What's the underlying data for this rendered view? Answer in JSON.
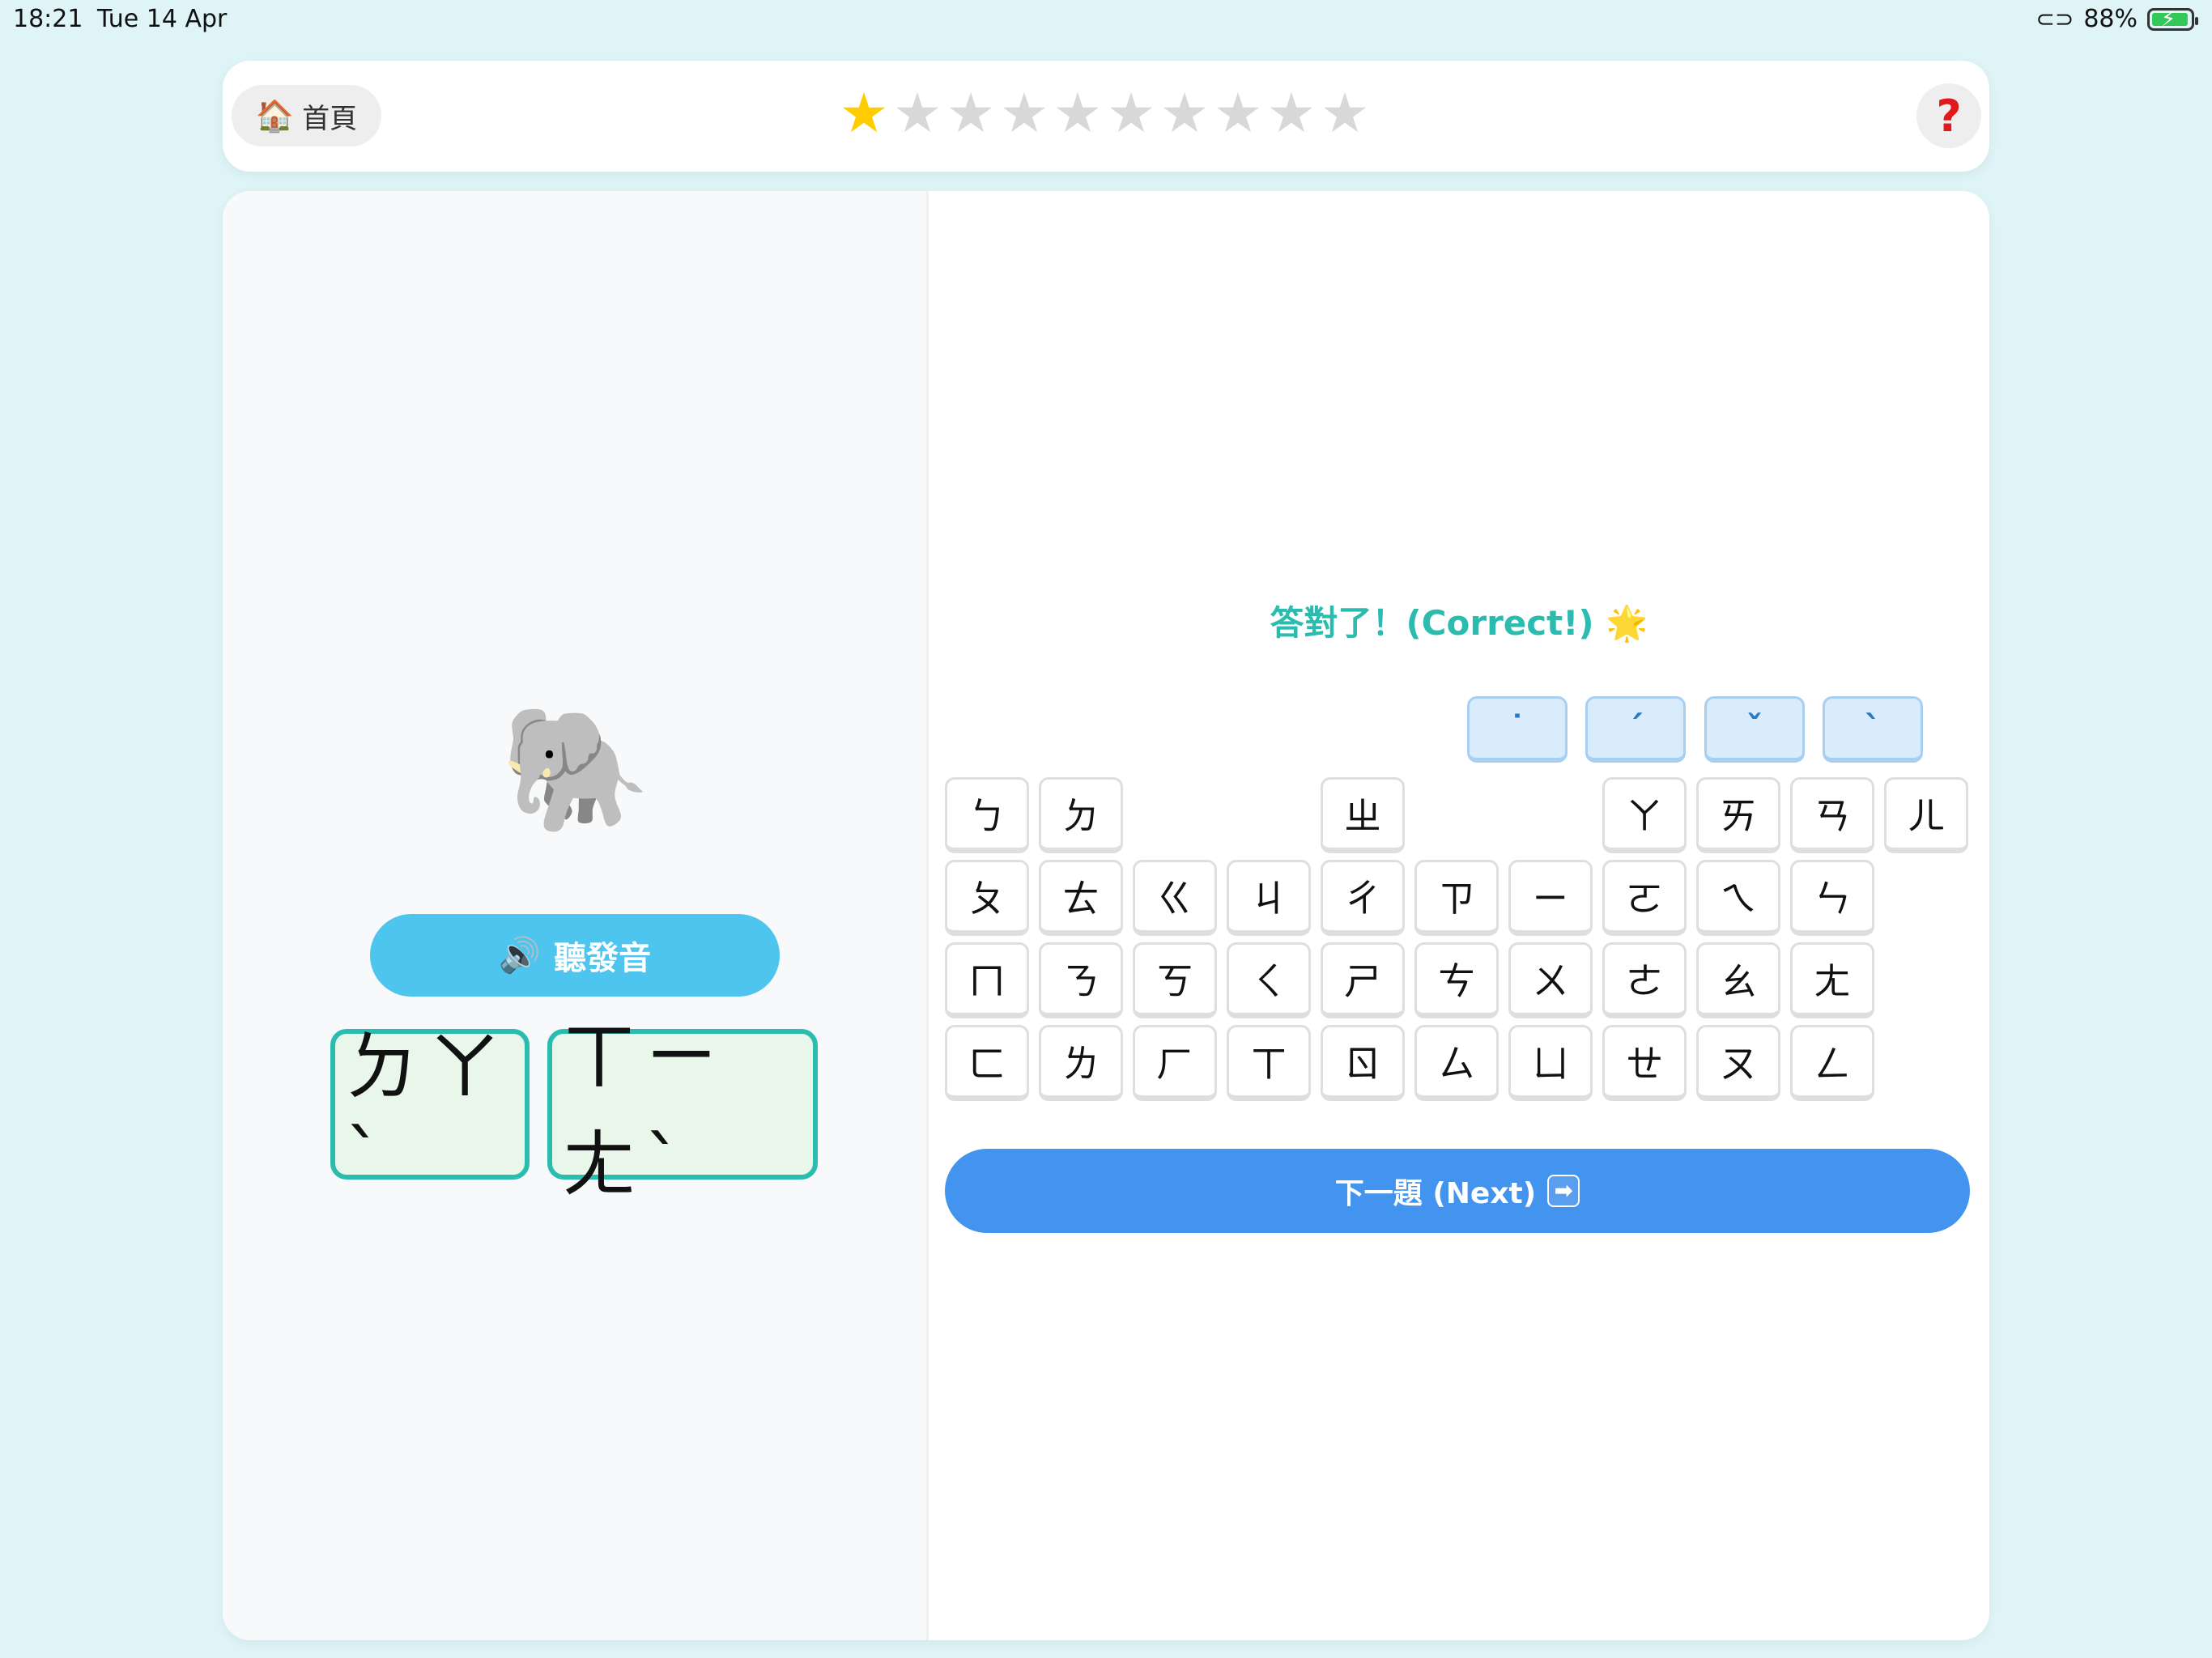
{
  "status_bar": {
    "time": "18:21",
    "date": "Tue 14 Apr",
    "battery_percent": "88%",
    "link_icon": "link-icon",
    "battery_icon": "battery-charging-icon"
  },
  "top_bar": {
    "home_label": "首頁",
    "home_icon": "house-icon",
    "stars_total": 10,
    "stars_filled": 1,
    "star_glyph": "★",
    "help_label": "?",
    "colors": {
      "star_filled": "#ffcc00",
      "star_empty": "#d8d8d8",
      "help": "#e0191c"
    }
  },
  "left_panel": {
    "emoji": "🐘",
    "emoji_icon": "elephant-icon",
    "listen_label": "聽發音",
    "listen_icon": "🔊",
    "answer": [
      "ㄉㄚˋ",
      "ㄒㄧㄤˋ"
    ]
  },
  "right_panel": {
    "feedback": "答對了！(Correct!) 🌟",
    "tones": [
      "˙",
      "ˊ",
      "ˇ",
      "ˋ"
    ],
    "backspace_label": "⌫",
    "keyboard": [
      [
        "ㄅ",
        "ㄉ",
        "",
        "",
        "ㄓ",
        "",
        "",
        "ㄚ",
        "ㄞ",
        "ㄢ",
        "ㄦ"
      ],
      [
        "ㄆ",
        "ㄊ",
        "ㄍ",
        "ㄐ",
        "ㄔ",
        "ㄗ",
        "ㄧ",
        "ㄛ",
        "ㄟ",
        "ㄣ"
      ],
      [
        "ㄇ",
        "ㄋ",
        "ㄎ",
        "ㄑ",
        "ㄕ",
        "ㄘ",
        "ㄨ",
        "ㄜ",
        "ㄠ",
        "ㄤ"
      ],
      [
        "ㄈ",
        "ㄌ",
        "ㄏ",
        "ㄒ",
        "ㄖ",
        "ㄙ",
        "ㄩ",
        "ㄝ",
        "ㄡ",
        "ㄥ"
      ]
    ],
    "next_label": "下一題 (Next)",
    "next_icon": "➡",
    "colors": {
      "accent": "#2bbcb0",
      "next": "#4294ee",
      "listen": "#4dc5ee"
    }
  }
}
